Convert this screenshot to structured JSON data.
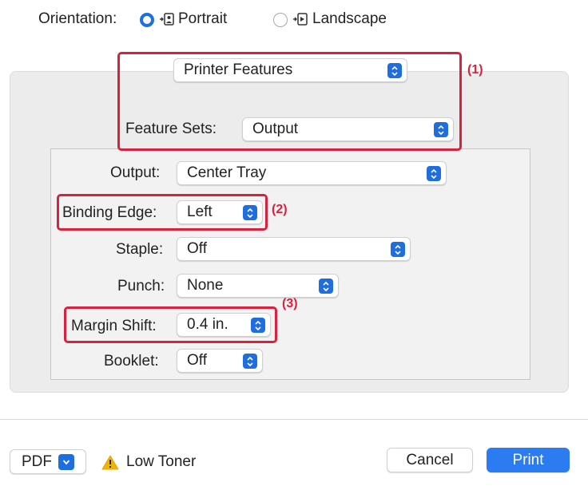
{
  "orientation": {
    "label": "Orientation:",
    "options": [
      {
        "label": "Portrait",
        "selected": true
      },
      {
        "label": "Landscape",
        "selected": false
      }
    ]
  },
  "panel_selector": {
    "value": "Printer Features"
  },
  "feature_sets": {
    "label": "Feature Sets:",
    "value": "Output"
  },
  "fields": {
    "output": {
      "label": "Output:",
      "value": "Center Tray"
    },
    "binding_edge": {
      "label": "Binding Edge:",
      "value": "Left"
    },
    "staple": {
      "label": "Staple:",
      "value": "Off"
    },
    "punch": {
      "label": "Punch:",
      "value": "None"
    },
    "margin_shift": {
      "label": "Margin Shift:",
      "value": "0.4 in."
    },
    "booklet": {
      "label": "Booklet:",
      "value": "Off"
    }
  },
  "callouts": {
    "c1": "(1)",
    "c2": "(2)",
    "c3": "(3)"
  },
  "footer": {
    "pdf_label": "PDF",
    "warning_text": "Low Toner",
    "cancel_label": "Cancel",
    "print_label": "Print"
  },
  "colors": {
    "accent": "#1f6ee0",
    "highlight": "#d9203c",
    "warning": "#f0b400"
  }
}
